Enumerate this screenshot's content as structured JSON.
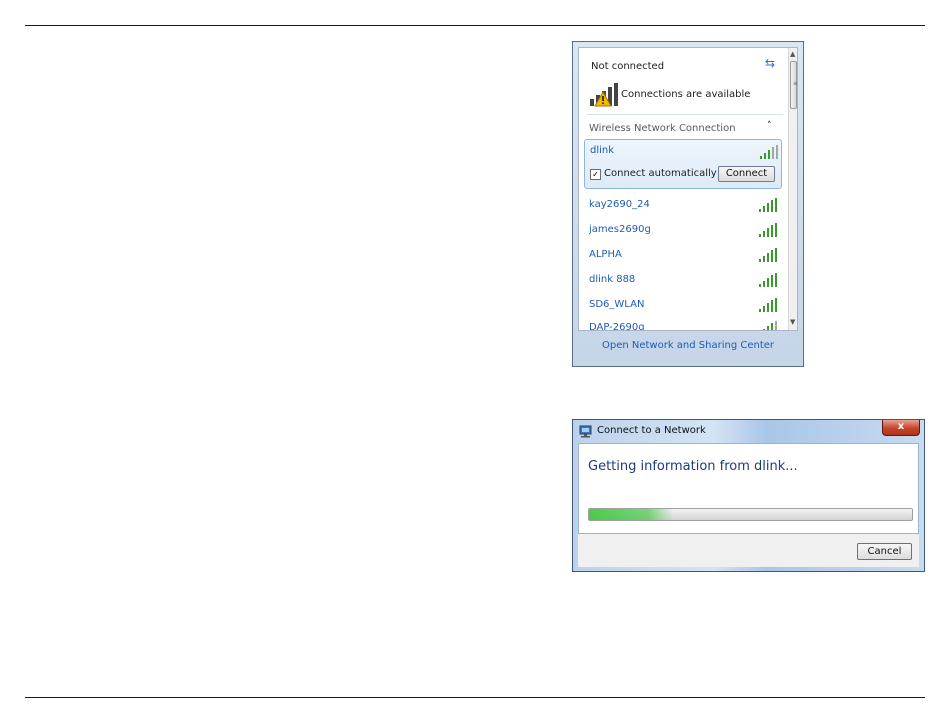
{
  "network_flyout": {
    "status": "Not connected",
    "availability": "Connections are available",
    "section_title": "Wireless Network Connection",
    "selected_network": {
      "name": "dlink",
      "connect_auto_label": "Connect automatically",
      "connect_auto_checked": true,
      "connect_button": "Connect"
    },
    "networks": [
      "kay2690_24",
      "james2690g",
      "ALPHA",
      "dlink 888",
      "SD6_WLAN",
      "DAP-2690g"
    ],
    "footer_link": "Open Network and Sharing Center",
    "icons": {
      "refresh": "refresh-icon",
      "availability": "signal-available-icon",
      "collapse": "chevron-up-icon",
      "signal": "signal-strength-icon"
    },
    "colors": {
      "link": "#1f5bb4",
      "signal_green": "#3a9a2c"
    }
  },
  "connect_dialog": {
    "title": "Connect to a Network",
    "message": "Getting information from dlink...",
    "progress_fraction": 0.26,
    "cancel_button": "Cancel",
    "close_label": "x",
    "colors": {
      "progress": "#3cc83c",
      "close": "#c2452c"
    }
  }
}
